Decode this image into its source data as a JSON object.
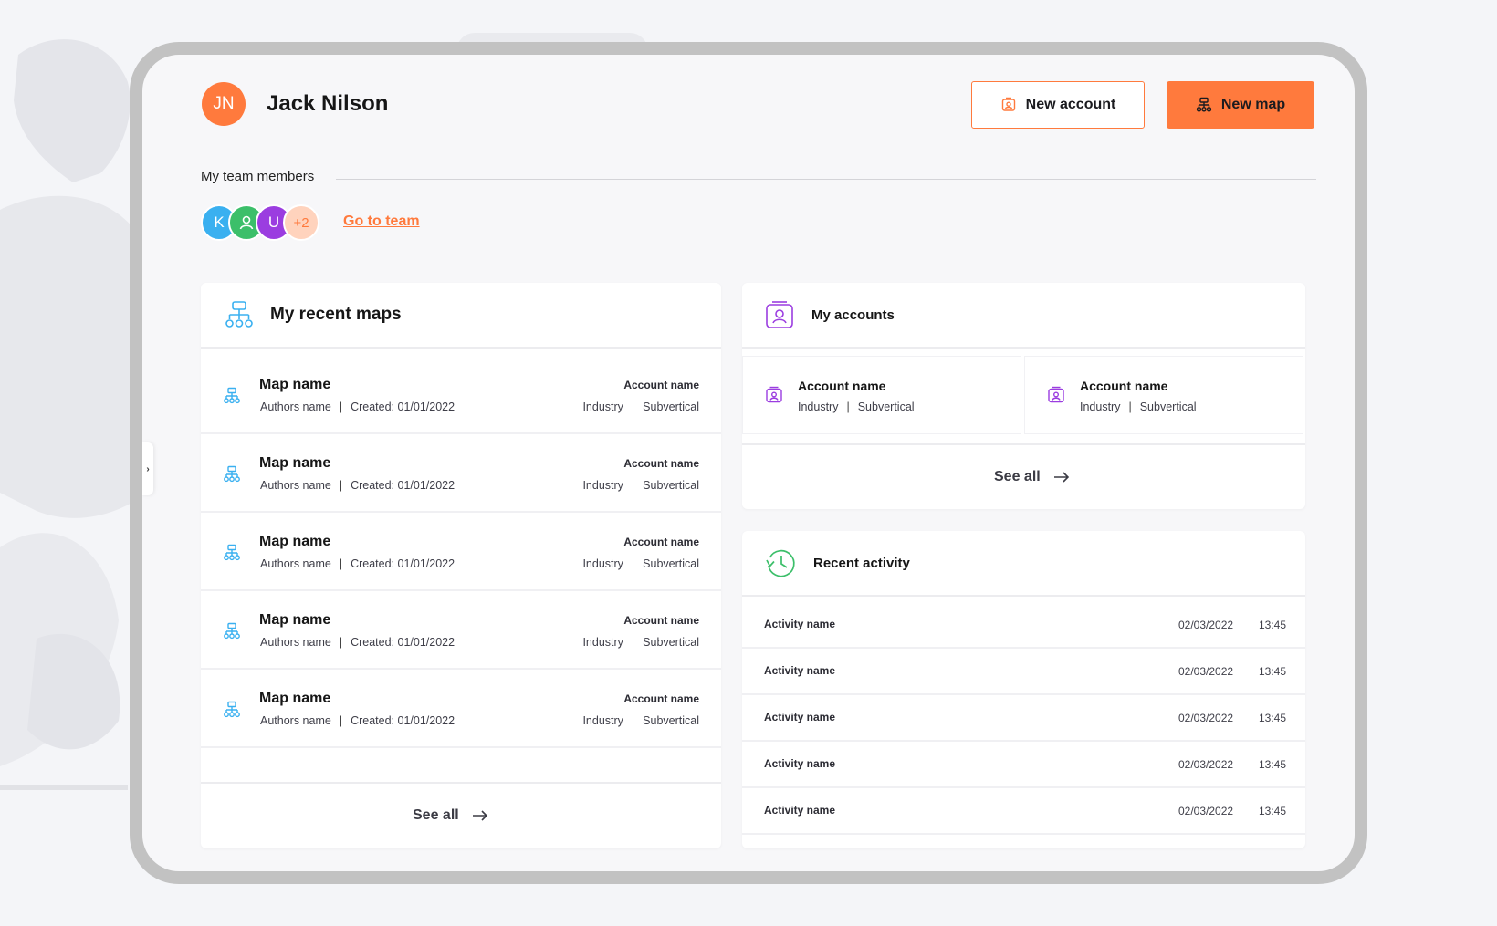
{
  "colors": {
    "accent": "#ff7a3d",
    "maps_icon": "#3ab0f0",
    "accounts_icon": "#9b3de0",
    "activity_icon": "#3cbf6a"
  },
  "user": {
    "initials": "JN",
    "name": "Jack Nilson"
  },
  "header": {
    "new_account_label": "New account",
    "new_account_icon": "account-badge-icon",
    "new_map_label": "New map",
    "new_map_icon": "sitemap-icon"
  },
  "team": {
    "label": "My team members",
    "members": [
      {
        "initial": "K",
        "color": "#3ab0f0"
      },
      {
        "initial": "",
        "icon": "person-icon",
        "color": "#3cbf6a"
      },
      {
        "initial": "U",
        "color": "#9b3de0"
      }
    ],
    "extra_count": "+2",
    "go_to_team_label": "Go to team"
  },
  "recent_maps": {
    "title": "My recent maps",
    "see_all_label": "See all",
    "items": [
      {
        "name": "Map name",
        "author": "Authors name",
        "created": "Created: 01/01/2022",
        "account": "Account name",
        "industry": "Industry",
        "subvertical": "Subvertical"
      },
      {
        "name": "Map name",
        "author": "Authors name",
        "created": "Created: 01/01/2022",
        "account": "Account name",
        "industry": "Industry",
        "subvertical": "Subvertical"
      },
      {
        "name": "Map name",
        "author": "Authors name",
        "created": "Created: 01/01/2022",
        "account": "Account name",
        "industry": "Industry",
        "subvertical": "Subvertical"
      },
      {
        "name": "Map name",
        "author": "Authors name",
        "created": "Created: 01/01/2022",
        "account": "Account name",
        "industry": "Industry",
        "subvertical": "Subvertical"
      },
      {
        "name": "Map name",
        "author": "Authors name",
        "created": "Created: 01/01/2022",
        "account": "Account name",
        "industry": "Industry",
        "subvertical": "Subvertical"
      }
    ]
  },
  "accounts": {
    "title": "My accounts",
    "see_all_label": "See all",
    "items": [
      {
        "name": "Account name",
        "industry": "Industry",
        "subvertical": "Subvertical"
      },
      {
        "name": "Account name",
        "industry": "Industry",
        "subvertical": "Subvertical"
      }
    ]
  },
  "activity": {
    "title": "Recent activity",
    "items": [
      {
        "name": "Activity name",
        "date": "02/03/2022",
        "time": "13:45"
      },
      {
        "name": "Activity name",
        "date": "02/03/2022",
        "time": "13:45"
      },
      {
        "name": "Activity name",
        "date": "02/03/2022",
        "time": "13:45"
      },
      {
        "name": "Activity name",
        "date": "02/03/2022",
        "time": "13:45"
      },
      {
        "name": "Activity name",
        "date": "02/03/2022",
        "time": "13:45"
      }
    ]
  }
}
